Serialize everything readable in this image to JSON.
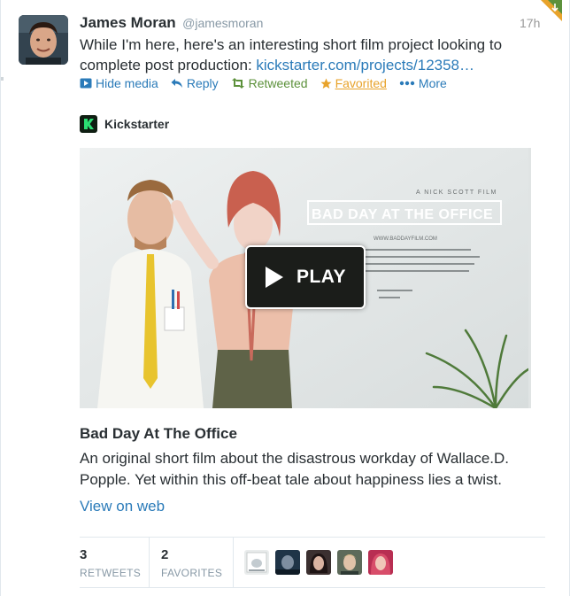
{
  "tweet": {
    "fullname": "James Moran",
    "username": "@jamesmoran",
    "timestamp": "17h",
    "text_before": "While I'm here, here's an interesting short film project looking to complete post production: ",
    "link": "kickstarter.com/projects/12358…"
  },
  "actions": {
    "hide_media": "Hide media",
    "reply": "Reply",
    "retweeted": "Retweeted",
    "favorited": "Favorited",
    "more": "More"
  },
  "card": {
    "source_name": "Kickstarter",
    "poster_credit": "A NICK SCOTT FILM",
    "poster_title": "BAD DAY AT THE OFFICE",
    "poster_url": "WWW.BADDAYFILM.COM",
    "play_label": "PLAY",
    "title": "Bad Day At The Office",
    "description": "An original short film about the disastrous workday of Wallace.D. Popple. Yet within this off-beat tale about happiness lies a twist.",
    "view_on_web": "View on web"
  },
  "stats": {
    "retweets_count": "3",
    "retweets_label": "RETWEETS",
    "favorites_count": "2",
    "favorites_label": "FAVORITES"
  },
  "colors": {
    "link": "#2b7bb9",
    "retweeted": "#5c913b",
    "favorited": "#e8a32b",
    "text": "#292f33",
    "muted": "#8899a6"
  }
}
